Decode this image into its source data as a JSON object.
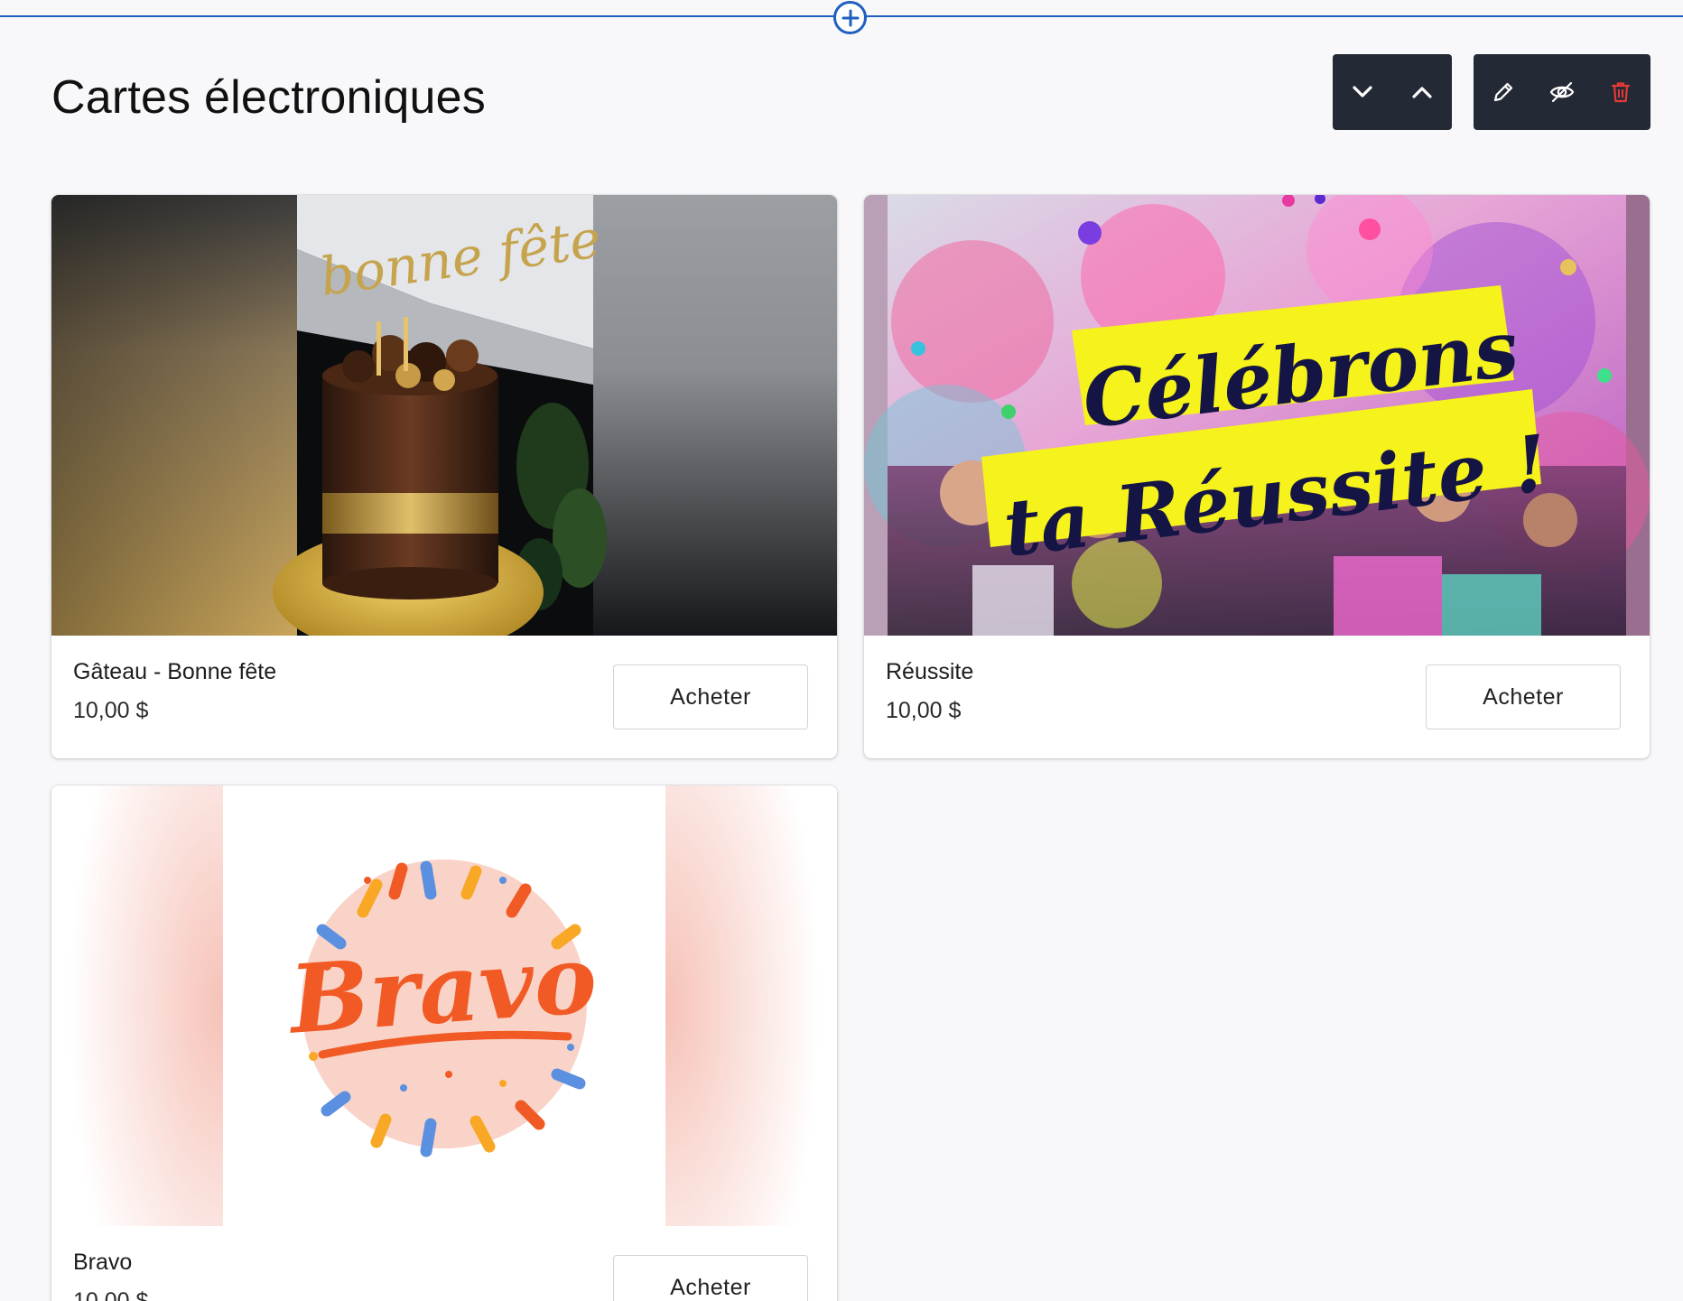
{
  "page": {
    "title": "Cartes électroniques"
  },
  "colors": {
    "accent": "#1f5fbf",
    "toolbar_bg": "#242a35",
    "delete": "#e53935"
  },
  "toolbar": {
    "move_down_icon": "chevron-down-icon",
    "move_up_icon": "chevron-up-icon",
    "edit_icon": "pencil-icon",
    "hide_icon": "eye-off-icon",
    "delete_icon": "trash-icon"
  },
  "cards": [
    {
      "name": "Gâteau - Bonne fête",
      "price": "10,00 $",
      "button": "Acheter",
      "image_text": "bonne fête"
    },
    {
      "name": "Réussite",
      "price": "10,00 $",
      "button": "Acheter",
      "image_text_line1": "Célébrons",
      "image_text_line2": "ta Réussite !"
    },
    {
      "name": "Bravo",
      "price": "10,00 $",
      "button": "Acheter",
      "image_text": "Bravo"
    }
  ]
}
